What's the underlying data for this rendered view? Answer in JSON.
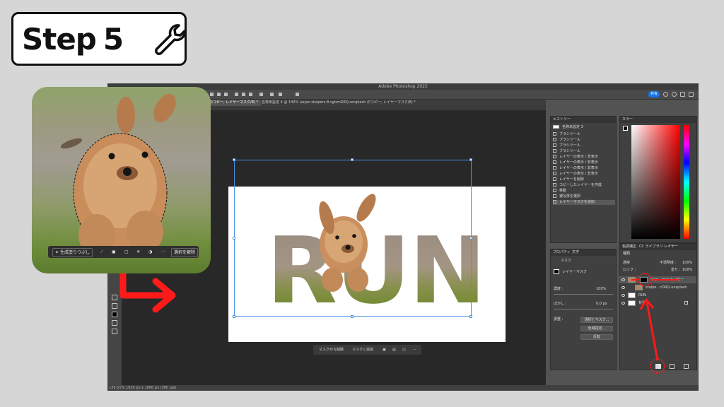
{
  "step_badge": {
    "label": "Step",
    "number": "5"
  },
  "window": {
    "title": "Adobe Photoshop 2025"
  },
  "options_bar": {
    "share_label": "共有"
  },
  "tabs": [
    {
      "label": "のコピー, レイヤーマスク/8) *"
    },
    {
      "label": "名称未設定 4 @ 143% (arjan-stalpers-8-sgismDRQ-unsplash のコピー, レイヤーマスク/8) *"
    }
  ],
  "document": {
    "run_text": "RUN"
  },
  "context_bar": {
    "subtract": "マスクから削除",
    "add": "マスクに追加",
    "more": "···"
  },
  "status_bar": {
    "zoom": "139.51%",
    "size": "1920 px x 1080 px (300 ppi)"
  },
  "history_panel": {
    "title": "ヒストリー",
    "snapshot": "名称未設定 3",
    "items": [
      "ブラシツール",
      "ブラシツール",
      "ブラシツール",
      "ブラシツール",
      "レイヤーの表示 / 非表示",
      "レイヤーの表示 / 非表示",
      "レイヤーの表示 / 非表示",
      "レイヤーの表示 / 非表示",
      "レイヤーを削除",
      "コピーしたレイヤーを作成",
      "移動",
      "被写体を選択",
      "レイヤーマスクを追加"
    ]
  },
  "properties_panel": {
    "tab_properties": "プロパティ",
    "tab_char": "文字",
    "mask_label": "マスク",
    "layer_mask_label": "レイヤーマスク",
    "density_label": "濃度 :",
    "density_value": "100%",
    "feather_label": "ぼかし :",
    "feather_value": "0.0 px",
    "refine_label": "調整 :",
    "btn_select_mask": "選択とマスク...",
    "btn_color_range": "色域指定...",
    "btn_invert": "反転"
  },
  "color_panel": {
    "title": "カラー"
  },
  "layers_panel": {
    "tab_adjust": "色調補正",
    "tab_library": "CC ライブラリ",
    "tab_layers": "レイヤー",
    "filter_kind": "種類",
    "blend_mode": "通常",
    "opacity_label": "不透明度 :",
    "opacity_value": "100%",
    "lock_label": "ロック :",
    "fill_label": "塗り :",
    "fill_value": "100%",
    "layers": [
      {
        "name": "arja…lash のコピー",
        "selected": true
      },
      {
        "name": "stalpe…cDRQ-unsplash",
        "selected": false
      },
      {
        "name": "RUN",
        "selected": false
      },
      {
        "name": "背景",
        "selected": false
      }
    ]
  },
  "inset": {
    "generative_fill": "生成塗りつぶし",
    "deselect": "選択を解除",
    "more": "···"
  },
  "colors": {
    "accent_red": "#ff1a1a",
    "selection_blue": "#4a90e2",
    "share_blue": "#1473e6"
  }
}
